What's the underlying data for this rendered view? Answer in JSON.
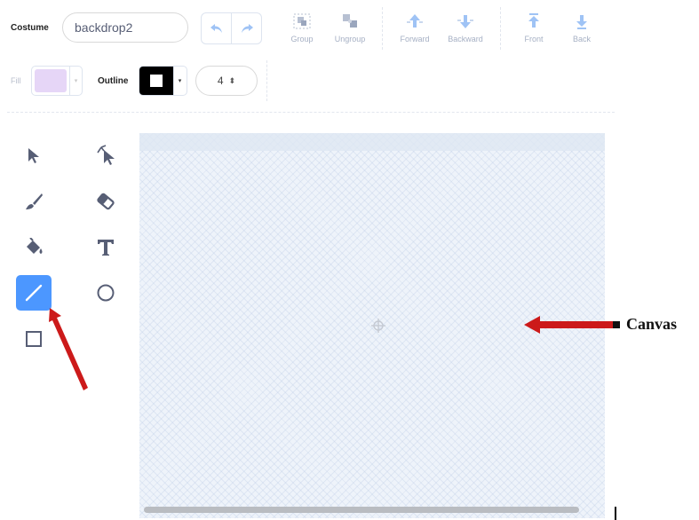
{
  "toolbar": {
    "costume_label": "Costume",
    "costume_name": "backdrop2",
    "undo_icon": "undo-icon",
    "redo_icon": "redo-icon",
    "buttons": [
      {
        "label": "Group",
        "icon": "group-icon"
      },
      {
        "label": "Ungroup",
        "icon": "ungroup-icon"
      },
      {
        "label": "Forward",
        "icon": "forward-icon"
      },
      {
        "label": "Backward",
        "icon": "backward-icon"
      },
      {
        "label": "Front",
        "icon": "front-icon"
      },
      {
        "label": "Back",
        "icon": "back-icon"
      }
    ]
  },
  "properties": {
    "fill_label": "Fill",
    "fill_color": "#e6d6f7",
    "outline_label": "Outline",
    "outline_color": "#000000",
    "outline_width": "4"
  },
  "tools": [
    {
      "name": "select",
      "icon": "select-arrow-icon",
      "active": false
    },
    {
      "name": "reshape",
      "icon": "reshape-icon",
      "active": false
    },
    {
      "name": "brush",
      "icon": "brush-icon",
      "active": false
    },
    {
      "name": "eraser",
      "icon": "eraser-icon",
      "active": false
    },
    {
      "name": "fill",
      "icon": "fill-bucket-icon",
      "active": false
    },
    {
      "name": "text",
      "icon": "text-icon",
      "active": false
    },
    {
      "name": "line",
      "icon": "line-icon",
      "active": true
    },
    {
      "name": "circle",
      "icon": "circle-icon",
      "active": false
    },
    {
      "name": "rectangle",
      "icon": "rectangle-icon",
      "active": false
    }
  ],
  "canvas": {
    "center_icon": "crosshair-icon"
  },
  "annotation": {
    "canvas_label": "Canvas",
    "arrow_color": "#cc1a1a"
  },
  "colors": {
    "accent": "#4c97ff",
    "icon_muted": "#a6b0c4",
    "text": "#575e75"
  }
}
